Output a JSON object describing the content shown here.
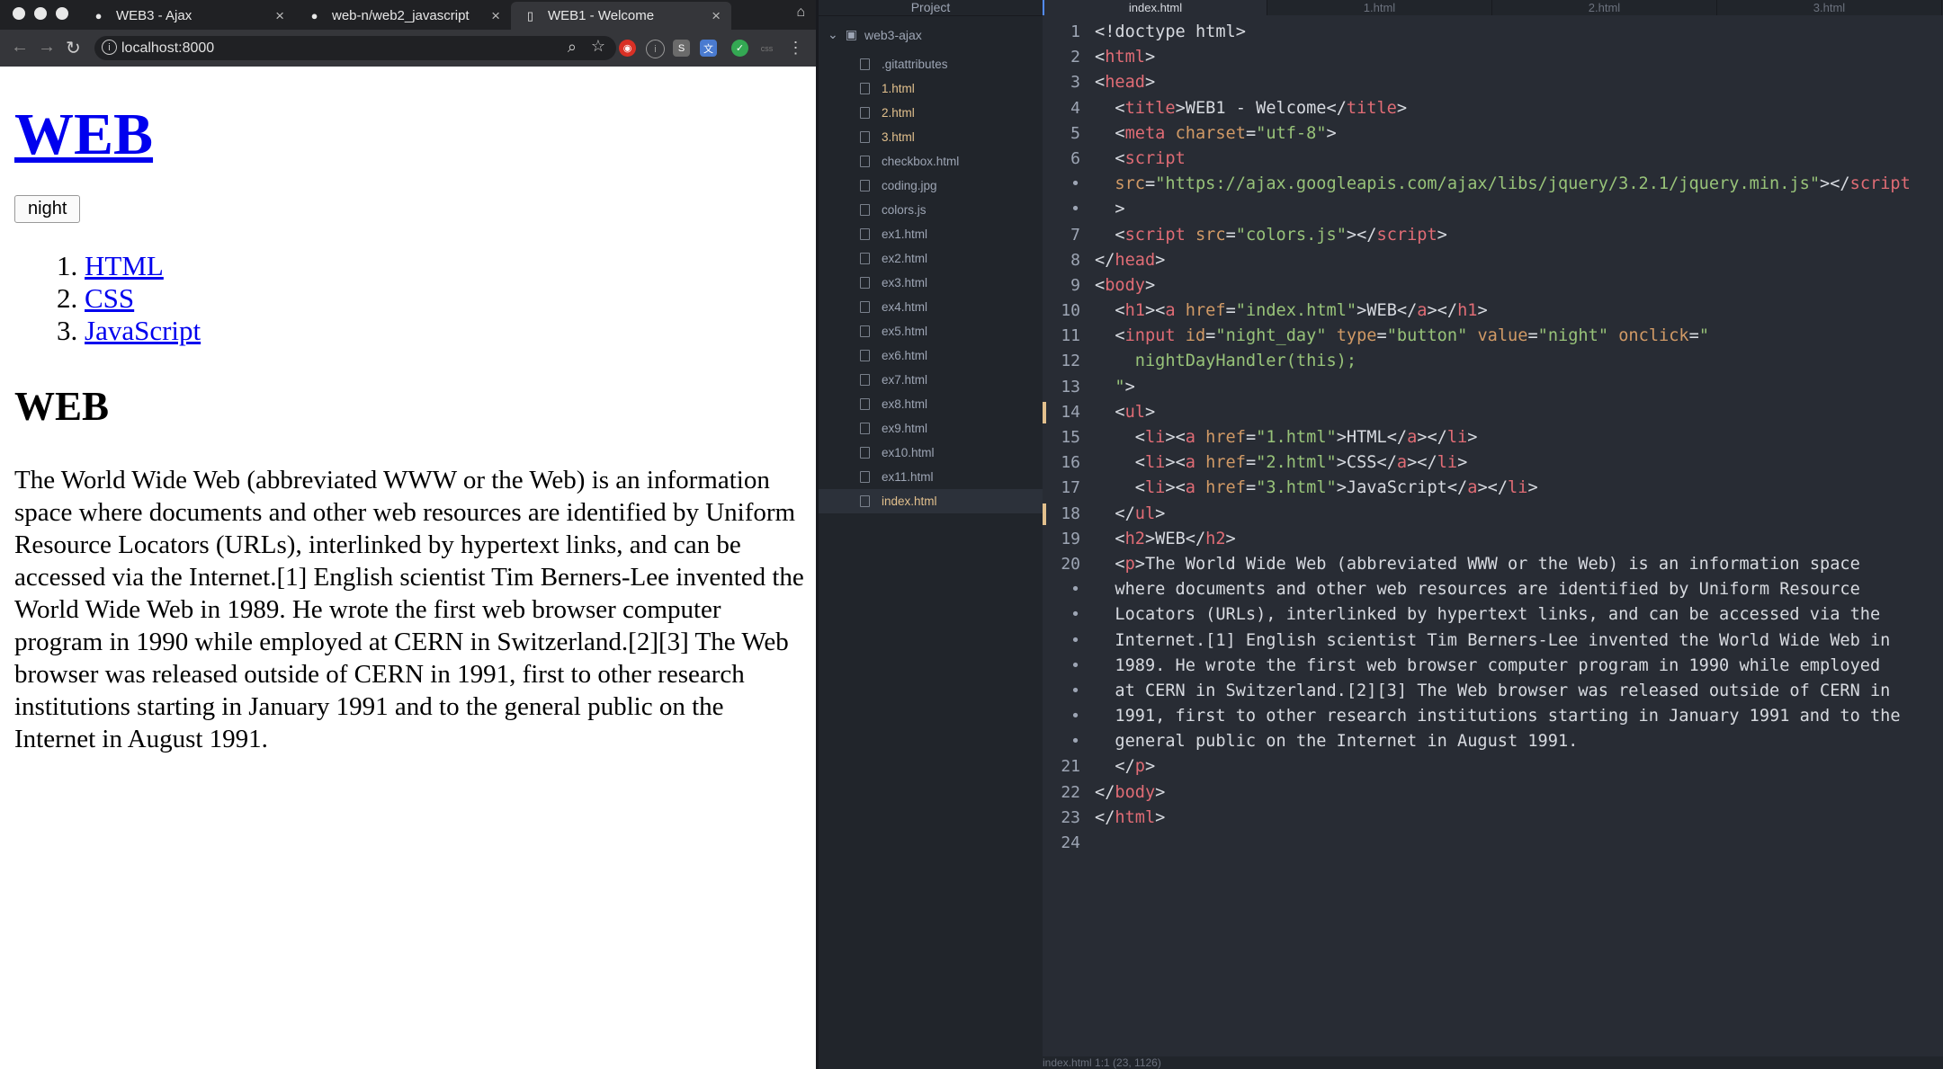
{
  "browser": {
    "tabs": [
      {
        "title": "WEB3 - Ajax",
        "icon": "github-icon"
      },
      {
        "title": "web-n/web2_javascript",
        "icon": "github-icon"
      },
      {
        "title": "WEB1 - Welcome",
        "icon": "page-icon"
      }
    ],
    "url": "localhost:8000",
    "page": {
      "h1": "WEB",
      "button": "night",
      "list": [
        "HTML",
        "CSS",
        "JavaScript"
      ],
      "h2": "WEB",
      "paragraph": "The World Wide Web (abbreviated WWW or the Web) is an information space where documents and other web resources are identified by Uniform Resource Locators (URLs), interlinked by hypertext links, and can be accessed via the Internet.[1] English scientist Tim Berners-Lee invented the World Wide Web in 1989. He wrote the first web browser computer program in 1990 while employed at CERN in Switzerland.[2][3] The Web browser was released outside of CERN in 1991, first to other research institutions starting in January 1991 and to the general public on the Internet in August 1991."
    }
  },
  "editor": {
    "project_label": "Project",
    "root": "web3-ajax",
    "files": [
      ".gitattributes",
      "1.html",
      "2.html",
      "3.html",
      "checkbox.html",
      "coding.jpg",
      "colors.js",
      "ex1.html",
      "ex2.html",
      "ex3.html",
      "ex4.html",
      "ex5.html",
      "ex6.html",
      "ex7.html",
      "ex8.html",
      "ex9.html",
      "ex10.html",
      "ex11.html",
      "index.html"
    ],
    "tabs": [
      "index.html",
      "1.html",
      "2.html",
      "3.html"
    ],
    "gutter": [
      "1",
      "2",
      "3",
      "4",
      "5",
      "6",
      "•",
      "•",
      "7",
      "8",
      "9",
      "10",
      "11",
      "12",
      "13",
      "14",
      "15",
      "16",
      "17",
      "18",
      "19",
      "20",
      "•",
      "•",
      "•",
      "•",
      "•",
      "•",
      "•",
      "21",
      "22",
      "23",
      "24"
    ],
    "status": "index.html   1:1   (23, 1126)"
  }
}
